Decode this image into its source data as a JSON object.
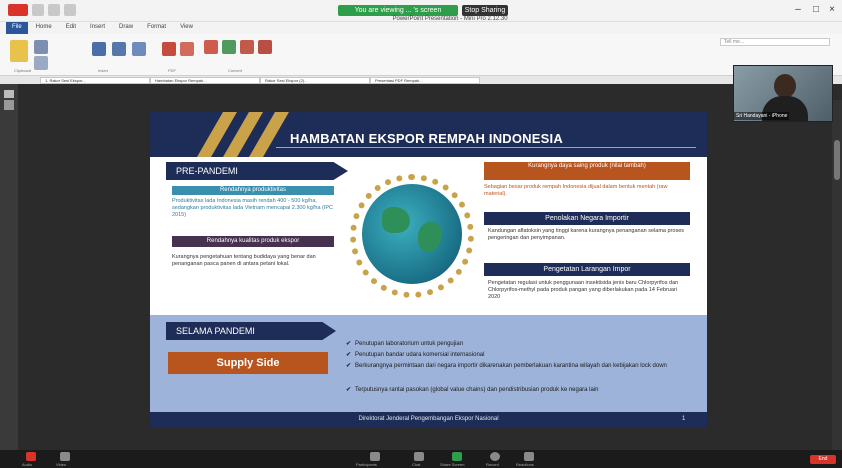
{
  "titlebar": {
    "share_status": "You are viewing ... 's screen",
    "stop_share": "Stop Sharing",
    "app_title": "PowerPoint Presentation - Mini Pro 2.12.30"
  },
  "ribbon": {
    "tabs": [
      "File",
      "Home",
      "Edit",
      "Insert",
      "Draw",
      "Format",
      "View"
    ],
    "active_tab": "File",
    "search_placeholder": "Tell me..."
  },
  "doc_tabs": [
    "1. Rakor Sesi Ekspor...",
    "Hambatan Ekspor Rempah...",
    "Rakor Sesi Ekspor (2)...",
    "Presentasi PDF Rempah..."
  ],
  "video": {
    "participant_name": "Sri Handayani - iPhone"
  },
  "slide": {
    "title": "HAMBATAN EKSPOR REMPAH INDONESIA",
    "pre_pandemi": {
      "heading": "PRE-PANDEMI",
      "productivity_label": "Rendahnya produktivitas",
      "productivity_text": "Produktivitas lada Indonesia masih rendah 400 - 500 kg/ha, sedangkan produktivitas lada Vietnam mencapai 2.300 kg/ha (IPC 2015)",
      "quality_label": "Rendahnya kualitas produk ekspor",
      "quality_text": "Kurangnya pengetahuan tentang budidaya yang benar dan penanganan pasca panen di antara petani lokal."
    },
    "right": {
      "competitiveness_label": "Kurangnya daya saing produk (nilai tambah)",
      "competitiveness_text": "Sebagian besar produk rempah Indonesia dijual dalam bentuk mentah (raw material).",
      "rejection_label": "Penolakan Negara Importir",
      "rejection_text": "Kandungan aflatoksin yang tinggi karena kurangnya penanganan selama proses pengeringan dan penyimpanan.",
      "ban_label": "Pengetatan Larangan Impor",
      "ban_text": "Pengetatan regulasi untuk penggunaan insektisida jenis baru Chlorpyrifos dan Chlorpyrifos-methyl pada produk pangan yang diberlakukan pada 14 Februari 2020"
    },
    "selama_pandemi": {
      "heading": "SELAMA PANDEMI",
      "supply_side": "Supply Side",
      "items": [
        "Penutupan laboratorium untuk pengujian",
        "Penutupan bandar udara komersial internasional",
        "Berkurangnya permintaan dari negara importir dikarenakan pemberlakuan karantina wilayah dan kebijakan lock down",
        "Terputusnya rantai pasokan (global value chains) dan pendistribusian produk ke negara lain"
      ]
    },
    "footer": "Direktorat Jenderal Pengembangan Ekspor Nasional",
    "page_number": "1"
  },
  "taskbar": {
    "labels": [
      "Audio",
      "Video",
      "Participants",
      "Chat",
      "Share Screen",
      "Record",
      "Reactions"
    ],
    "end": "End"
  },
  "colors": {
    "navy": "#1e2d57",
    "gold": "#c9a24a",
    "teal": "#3b8fae",
    "purple": "#46324f",
    "orange": "#b8551f",
    "panel_blue": "#9db3d9",
    "share_green": "#2e9e4a",
    "end_red": "#d9342b"
  }
}
